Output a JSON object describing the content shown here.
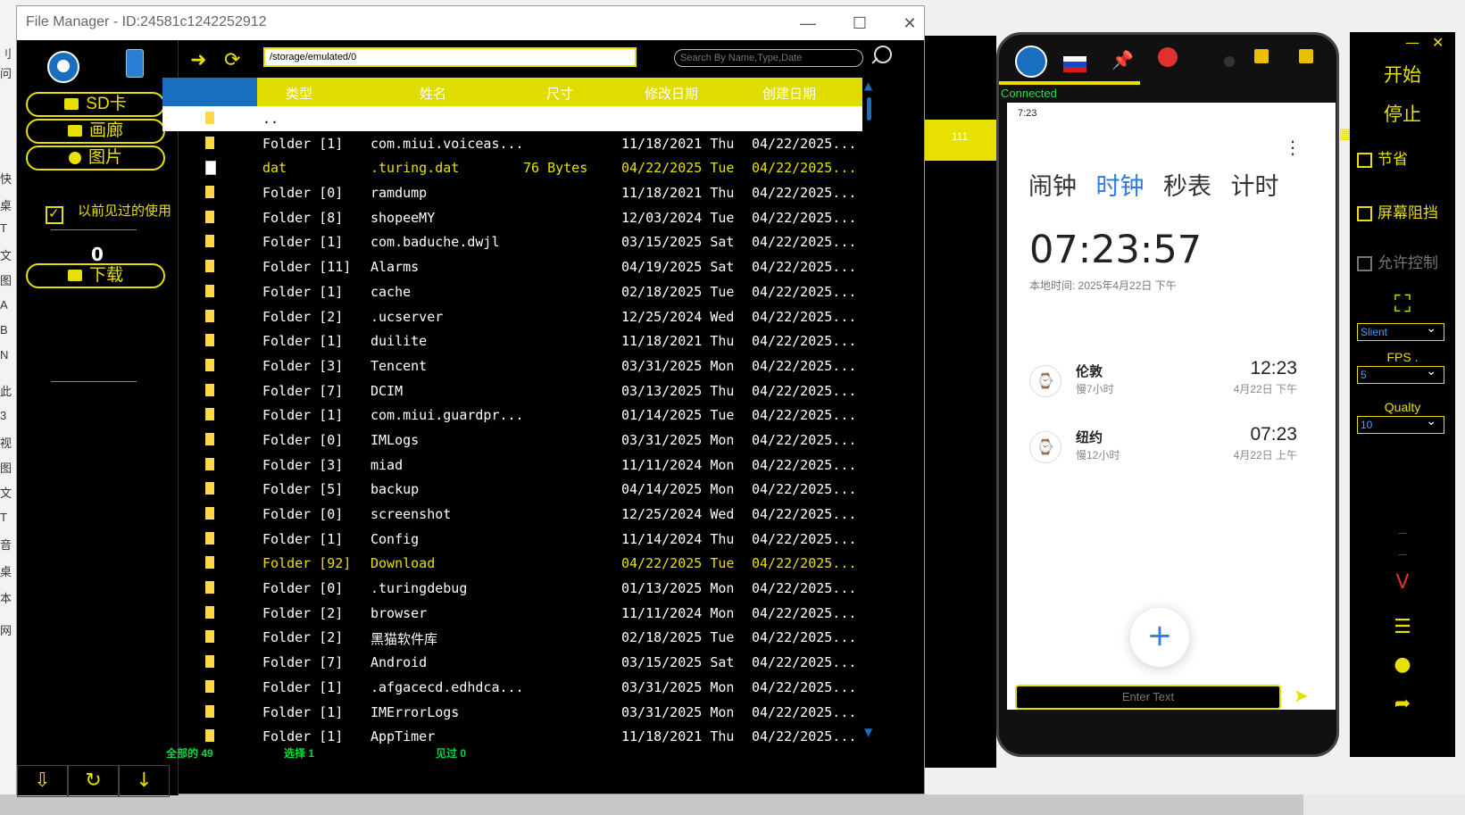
{
  "file_manager": {
    "title": "File Manager - ID:24581c1242252912",
    "path": "/storage/emulated/0",
    "search_placeholder": "Search By Name,Type,Date",
    "sidebar": {
      "sd_card": "SD卡",
      "gallery": "画廊",
      "pictures": "图片",
      "checkbox_label": "以前见过的使用",
      "count": "0",
      "download": "下载"
    },
    "columns": [
      "类型",
      "姓名",
      "尺寸",
      "修改日期",
      "创建日期"
    ],
    "rows": [
      {
        "type": "..",
        "name": "",
        "size": "",
        "modified": "",
        "created": "",
        "icon": "folder",
        "style": "first"
      },
      {
        "type": "Folder [1]",
        "name": "com.miui.voiceas...",
        "size": "",
        "modified": "11/18/2021 Thu",
        "created": "04/22/2025...",
        "icon": "folder"
      },
      {
        "type": "dat",
        "name": ".turing.dat",
        "size": "76 Bytes",
        "modified": "04/22/2025 Tue",
        "created": "04/22/2025...",
        "icon": "file",
        "style": "hl"
      },
      {
        "type": "Folder [0]",
        "name": "ramdump",
        "size": "",
        "modified": "11/18/2021 Thu",
        "created": "04/22/2025...",
        "icon": "folder"
      },
      {
        "type": "Folder [8]",
        "name": "shopeeMY",
        "size": "",
        "modified": "12/03/2024 Tue",
        "created": "04/22/2025...",
        "icon": "folder"
      },
      {
        "type": "Folder [1]",
        "name": "com.baduche.dwjl",
        "size": "",
        "modified": "03/15/2025 Sat",
        "created": "04/22/2025...",
        "icon": "folder"
      },
      {
        "type": "Folder [11]",
        "name": "Alarms",
        "size": "",
        "modified": "04/19/2025 Sat",
        "created": "04/22/2025...",
        "icon": "folder"
      },
      {
        "type": "Folder [1]",
        "name": "cache",
        "size": "",
        "modified": "02/18/2025 Tue",
        "created": "04/22/2025...",
        "icon": "folder"
      },
      {
        "type": "Folder [2]",
        "name": ".ucserver",
        "size": "",
        "modified": "12/25/2024 Wed",
        "created": "04/22/2025...",
        "icon": "folder"
      },
      {
        "type": "Folder [1]",
        "name": "duilite",
        "size": "",
        "modified": "11/18/2021 Thu",
        "created": "04/22/2025...",
        "icon": "folder"
      },
      {
        "type": "Folder [3]",
        "name": "Tencent",
        "size": "",
        "modified": "03/31/2025 Mon",
        "created": "04/22/2025...",
        "icon": "folder"
      },
      {
        "type": "Folder [7]",
        "name": "DCIM",
        "size": "",
        "modified": "03/13/2025 Thu",
        "created": "04/22/2025...",
        "icon": "folder"
      },
      {
        "type": "Folder [1]",
        "name": "com.miui.guardpr...",
        "size": "",
        "modified": "01/14/2025 Tue",
        "created": "04/22/2025...",
        "icon": "folder"
      },
      {
        "type": "Folder [0]",
        "name": "IMLogs",
        "size": "",
        "modified": "03/31/2025 Mon",
        "created": "04/22/2025...",
        "icon": "folder"
      },
      {
        "type": "Folder [3]",
        "name": "miad",
        "size": "",
        "modified": "11/11/2024 Mon",
        "created": "04/22/2025...",
        "icon": "folder"
      },
      {
        "type": "Folder [5]",
        "name": "backup",
        "size": "",
        "modified": "04/14/2025 Mon",
        "created": "04/22/2025...",
        "icon": "folder"
      },
      {
        "type": "Folder [0]",
        "name": "screenshot",
        "size": "",
        "modified": "12/25/2024 Wed",
        "created": "04/22/2025...",
        "icon": "folder"
      },
      {
        "type": "Folder [1]",
        "name": "Config",
        "size": "",
        "modified": "11/14/2024 Thu",
        "created": "04/22/2025...",
        "icon": "folder"
      },
      {
        "type": "Folder [92]",
        "name": "Download",
        "size": "",
        "modified": "04/22/2025 Tue",
        "created": "04/22/2025...",
        "icon": "folder",
        "style": "hl"
      },
      {
        "type": "Folder [0]",
        "name": ".turingdebug",
        "size": "",
        "modified": "01/13/2025 Mon",
        "created": "04/22/2025...",
        "icon": "folder"
      },
      {
        "type": "Folder [2]",
        "name": "browser",
        "size": "",
        "modified": "11/11/2024 Mon",
        "created": "04/22/2025...",
        "icon": "folder"
      },
      {
        "type": "Folder [2]",
        "name": "黑猫软件库",
        "size": "",
        "modified": "02/18/2025 Tue",
        "created": "04/22/2025...",
        "icon": "folder"
      },
      {
        "type": "Folder [7]",
        "name": "Android",
        "size": "",
        "modified": "03/15/2025 Sat",
        "created": "04/22/2025...",
        "icon": "folder"
      },
      {
        "type": "Folder [1]",
        "name": ".afgacecd.edhdca...",
        "size": "",
        "modified": "03/31/2025 Mon",
        "created": "04/22/2025...",
        "icon": "folder"
      },
      {
        "type": "Folder [1]",
        "name": "IMErrorLogs",
        "size": "",
        "modified": "03/31/2025 Mon",
        "created": "04/22/2025...",
        "icon": "folder"
      },
      {
        "type": "Folder [1]",
        "name": "AppTimer",
        "size": "",
        "modified": "11/18/2021 Thu",
        "created": "04/22/2025...",
        "icon": "folder"
      }
    ],
    "status": {
      "total": "全部的 49",
      "selected": "选择 1",
      "seen": "见过 0"
    }
  },
  "phone": {
    "connected": "Connected",
    "status_time": "7:23",
    "tabs": [
      "闹钟",
      "时钟",
      "秒表",
      "计时"
    ],
    "active_tab": "时钟",
    "clock": "07:23:57",
    "local_time": "本地时间: 2025年4月22日 下午",
    "cities": [
      {
        "name": "伦敦",
        "diff": "慢7小时",
        "time": "12:23",
        "date": "4月22日 下午"
      },
      {
        "name": "纽约",
        "diff": "慢12小时",
        "time": "07:23",
        "date": "4月22日 上午"
      }
    ],
    "enter_text_placeholder": "Enter Text"
  },
  "control_panel": {
    "start": "开始",
    "stop": "停止",
    "save": "节省",
    "screen_block": "屏幕阻挡",
    "allow_control": "允许控制",
    "mode": "Slient",
    "fps_label": "FPS .",
    "fps": "5",
    "quality_label": "Qualty",
    "quality": "10"
  },
  "background": {
    "left_labels": [
      "刂",
      "问",
      "快",
      "桌",
      "T",
      "文",
      "图",
      "A",
      "B",
      "N",
      "此",
      "3",
      "视",
      "图",
      "文",
      "T",
      "音",
      "桌",
      "本",
      "网"
    ],
    "mid_text": "111"
  },
  "colors": {
    "accent": "#e8e000",
    "header_selected": "#1a6ec0",
    "connected": "#2fd94c"
  }
}
